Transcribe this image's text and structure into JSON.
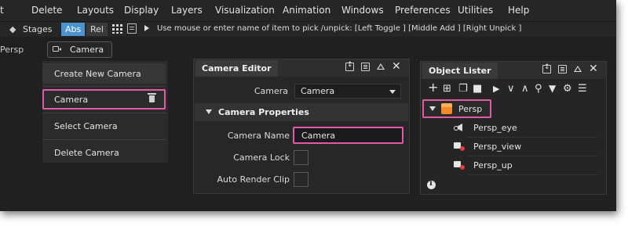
{
  "menu": {
    "items": [
      "t",
      "Delete",
      "Layouts",
      "Display",
      "Layers",
      "Visualization",
      "Animation",
      "Windows",
      "Preferences",
      "Utilities",
      "Help"
    ]
  },
  "toolbar": {
    "stages_label": "Stages",
    "abs_label": "Abs",
    "rel_label": "Rel",
    "hint": "Use mouse or enter name of item to pick /unpick: [Left Toggle ] [Middle Add ] [Right Unpick ]",
    "abs_color": "#4d93d1"
  },
  "camera_bar": {
    "persp_label": "Persp",
    "camera_button_label": "Camera"
  },
  "camera_menu": {
    "create": "Create New Camera",
    "camera": "Camera",
    "select": "Select Camera",
    "delete": "Delete Camera",
    "highlight_color": "#e05aa8"
  },
  "camera_editor": {
    "title": "Camera Editor",
    "camera_label": "Camera",
    "camera_value": "Camera",
    "section_title": "Camera Properties",
    "camera_name_label": "Camera Name",
    "camera_name_value": "Camera",
    "camera_lock_label": "Camera Lock",
    "auto_render_clip_label": "Auto Render Clip"
  },
  "object_lister": {
    "title": "Object Lister",
    "root": "Persp",
    "children": [
      "Persp_eye",
      "Persp_view",
      "Persp_up"
    ]
  }
}
